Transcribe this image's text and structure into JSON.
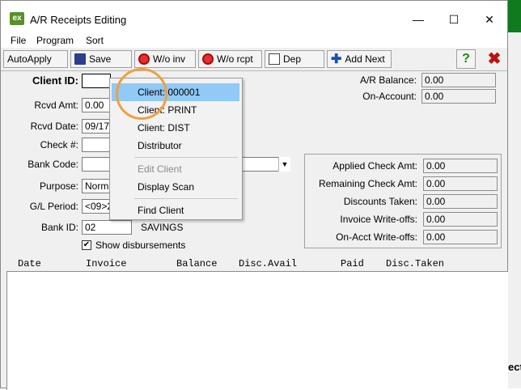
{
  "background": {
    "right_edge_label": "ecti"
  },
  "window": {
    "icon_label": "ex",
    "title": "A/R Receipts Editing",
    "minimize": "—",
    "maximize": "☐",
    "close": "✕"
  },
  "menu": [
    "File",
    "Program",
    "Sort"
  ],
  "toolbar": {
    "autoapply": "AutoApply",
    "save": "Save",
    "wo_inv": "W/o inv",
    "wo_rcpt": "W/o rcpt",
    "dep": "Dep",
    "add_next": "Add Next",
    "help": "?",
    "close": "✖"
  },
  "form": {
    "client_id_label": "Client ID:",
    "client_id_value": "",
    "rcvd_amt_label": "Rcvd Amt:",
    "rcvd_amt_value": "0.00",
    "rcvd_date_label": "Rcvd Date:",
    "rcvd_date_value": "09/17,",
    "check_label": "Check #:",
    "check_value": "",
    "bank_code_label": "Bank Code:",
    "bank_code_value": "",
    "purpose_label": "Purpose:",
    "purpose_value": "Norm",
    "gl_period_label": "G/L Period:",
    "gl_period_value": "<09>2",
    "bank_id_label": "Bank ID:",
    "bank_id_value": "02",
    "bank_name": "SAVINGS",
    "show_disb_label": "Show disbursements",
    "show_disb_check": "✔"
  },
  "balances": {
    "ar_balance_label": "A/R Balance:",
    "ar_balance_value": "0.00",
    "on_account_label": "On-Account:",
    "on_account_value": "0.00"
  },
  "summary": {
    "applied_label": "Applied Check Amt:",
    "applied_value": "0.00",
    "remaining_label": "Remaining Check Amt:",
    "remaining_value": "0.00",
    "discounts_label": "Discounts Taken:",
    "discounts_value": "0.00",
    "inv_wo_label": "Invoice Write-offs:",
    "inv_wo_value": "0.00",
    "acct_wo_label": "On-Acct Write-offs:",
    "acct_wo_value": "0.00"
  },
  "columns": [
    "Date",
    "Invoice",
    "Balance",
    "Disc.Avail",
    "Paid",
    "Disc.Taken"
  ],
  "popup": {
    "items": [
      "Client: 000001",
      "Client: PRINT",
      "Client: DIST",
      "Distributor",
      "Edit Client",
      "Display Scan",
      "Find Client"
    ]
  },
  "colors": {
    "highlight": "#91c9f7",
    "circle": "#f0a040",
    "bg_green": "#0f7a1e"
  }
}
